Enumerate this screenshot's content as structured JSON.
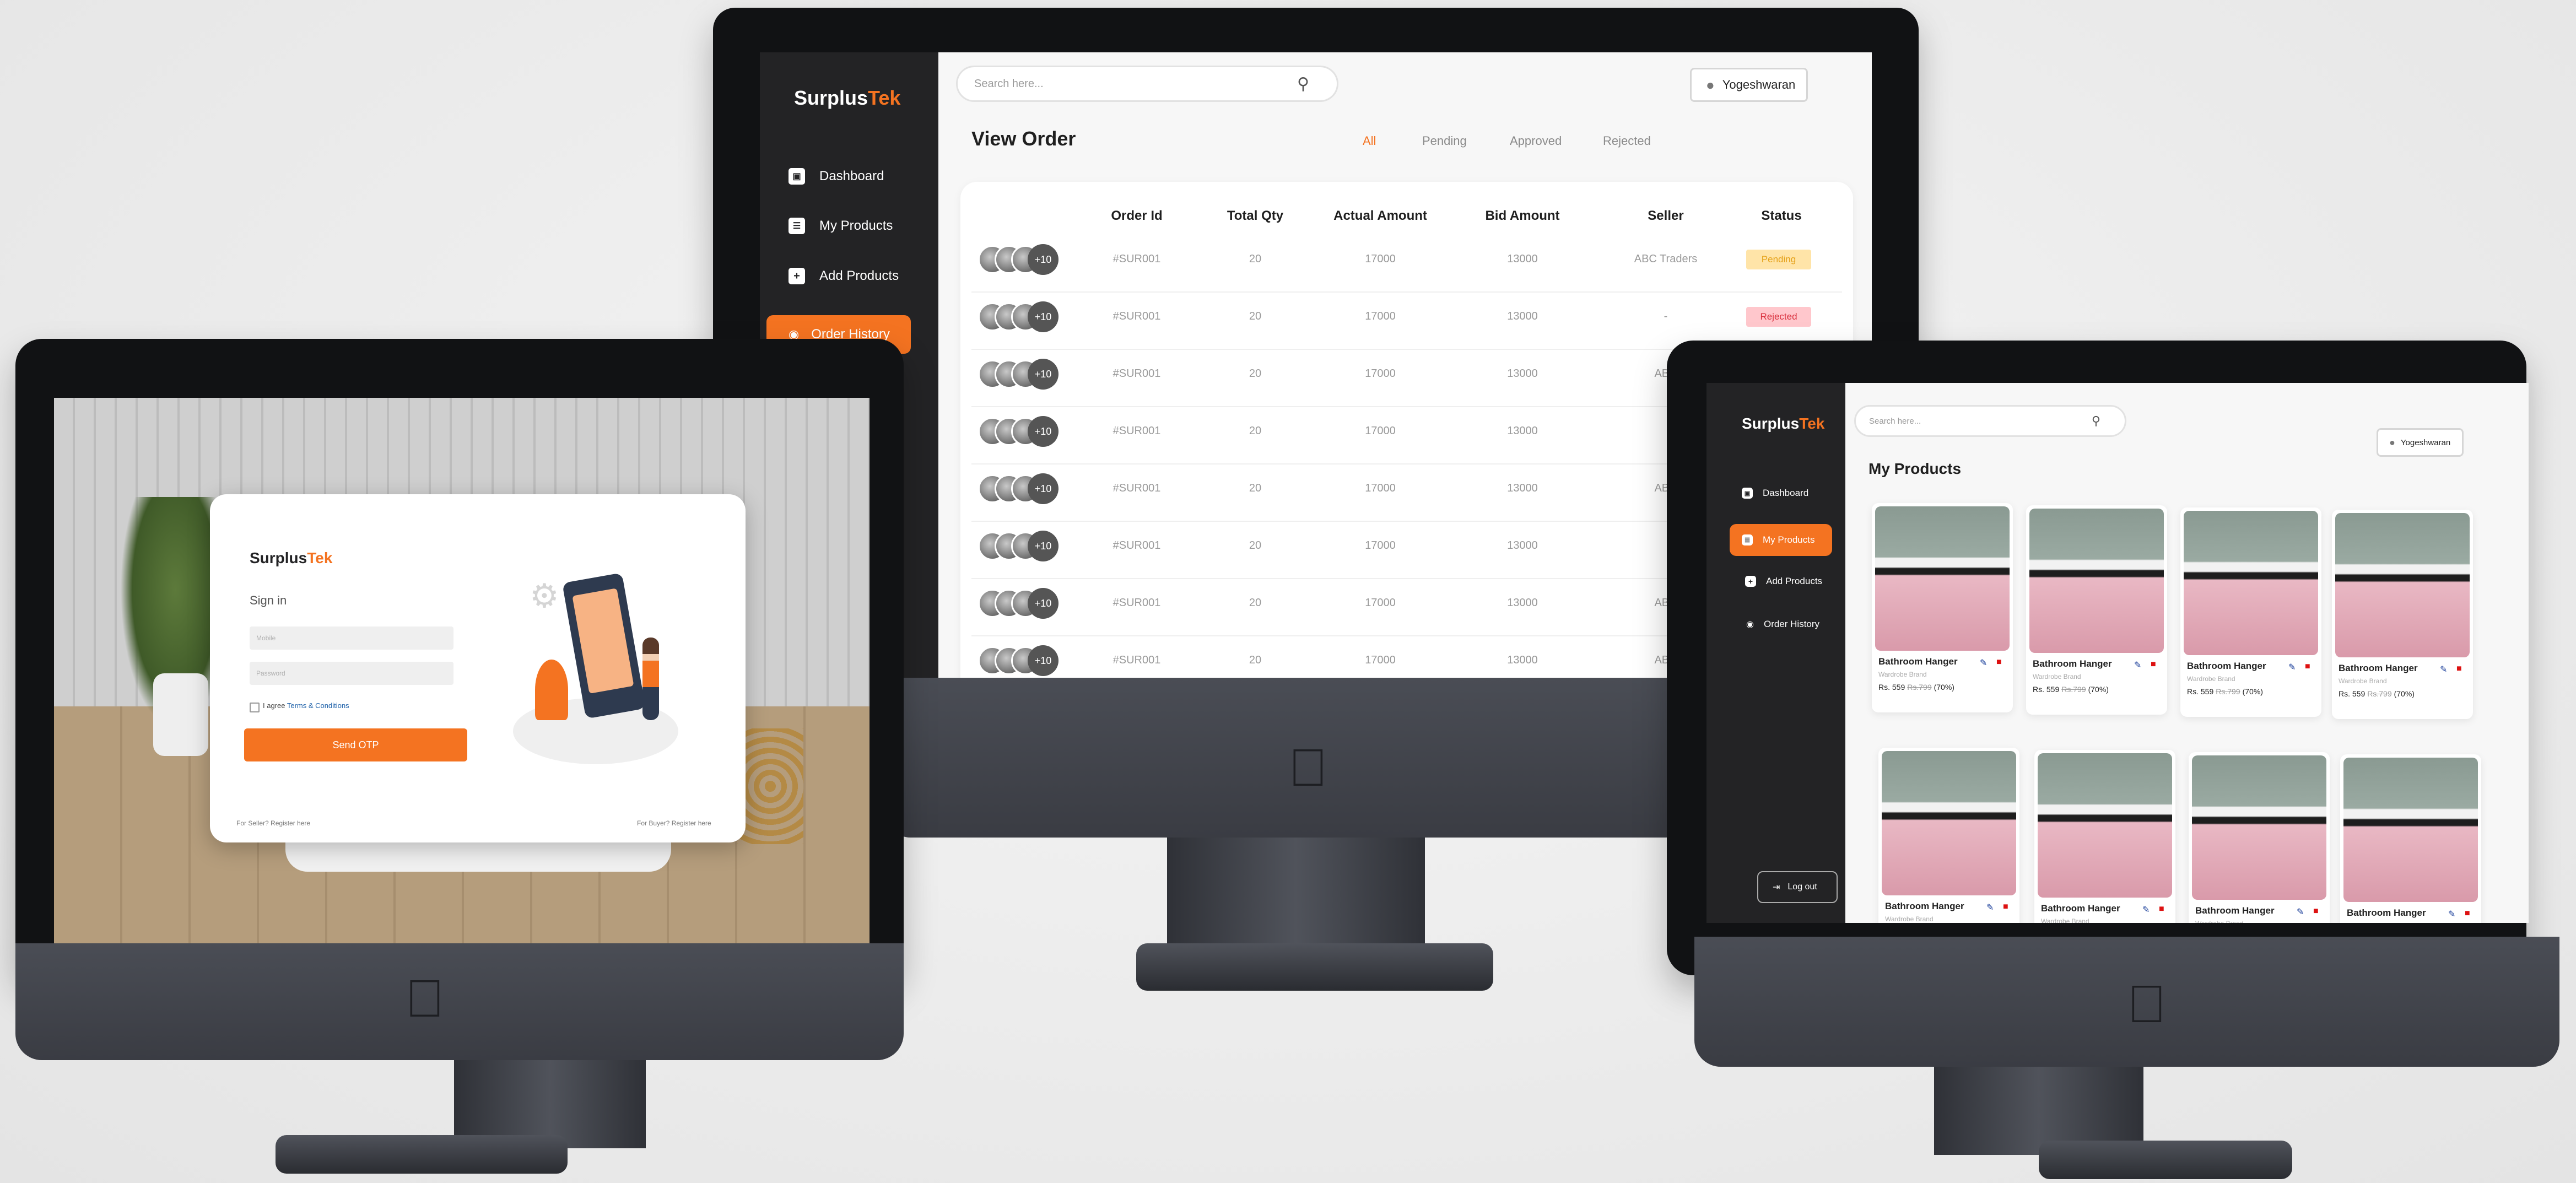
{
  "brand": {
    "name_a": "Surplus",
    "name_b": "Tek"
  },
  "colors": {
    "accent": "#f47321",
    "sidebar": "#232325"
  },
  "center": {
    "search_placeholder": "Search here...",
    "user_name": "Yogeshwaran",
    "nav": [
      {
        "label": "Dashboard",
        "icon": "dashboard-icon"
      },
      {
        "label": "My Products",
        "icon": "list-icon"
      },
      {
        "label": "Add Products",
        "icon": "plus-box-icon"
      },
      {
        "label": "Order History",
        "icon": "eye-icon",
        "active": true
      }
    ],
    "page_title": "View Order",
    "tabs": [
      "All",
      "Pending",
      "Approved",
      "Rejected"
    ],
    "columns": [
      "Order Id",
      "Total Qty",
      "Actual Amount",
      "Bid Amount",
      "Seller",
      "Status"
    ],
    "more_label": "+10",
    "rows": [
      {
        "id": "#SUR001",
        "qty": "20",
        "actual": "17000",
        "bid": "13000",
        "seller": "ABC Traders",
        "status": "Pending"
      },
      {
        "id": "#SUR001",
        "qty": "20",
        "actual": "17000",
        "bid": "13000",
        "seller": "-",
        "status": "Rejected"
      },
      {
        "id": "#SUR001",
        "qty": "20",
        "actual": "17000",
        "bid": "13000",
        "seller": "ABC",
        "status": ""
      },
      {
        "id": "#SUR001",
        "qty": "20",
        "actual": "17000",
        "bid": "13000",
        "seller": "",
        "status": ""
      },
      {
        "id": "#SUR001",
        "qty": "20",
        "actual": "17000",
        "bid": "13000",
        "seller": "ABC",
        "status": ""
      },
      {
        "id": "#SUR001",
        "qty": "20",
        "actual": "17000",
        "bid": "13000",
        "seller": "",
        "status": ""
      },
      {
        "id": "#SUR001",
        "qty": "20",
        "actual": "17000",
        "bid": "13000",
        "seller": "ABC",
        "status": ""
      },
      {
        "id": "#SUR001",
        "qty": "20",
        "actual": "17000",
        "bid": "13000",
        "seller": "ABC",
        "status": ""
      }
    ]
  },
  "left": {
    "signin_title": "Sign in",
    "mobile_placeholder": "Mobile",
    "password_placeholder": "Password",
    "agree_text": "I agree",
    "terms_link": "Terms & Conditions",
    "otp_button": "Send OTP",
    "seller_link": "For Seller? Register here",
    "buyer_link": "For Buyer? Register here"
  },
  "right": {
    "search_placeholder": "Search here...",
    "user_name": "Yogeshwaran",
    "nav": [
      {
        "label": "Dashboard"
      },
      {
        "label": "My Products",
        "active": true
      },
      {
        "label": "Add Products"
      },
      {
        "label": "Order History"
      }
    ],
    "logout": "Log out",
    "page_title": "My Products",
    "product": {
      "name": "Bathroom Hanger",
      "brand": "Wardrobe Brand",
      "price": "Rs. 559",
      "old_price": "Rs.799",
      "discount": "(70%)"
    }
  }
}
